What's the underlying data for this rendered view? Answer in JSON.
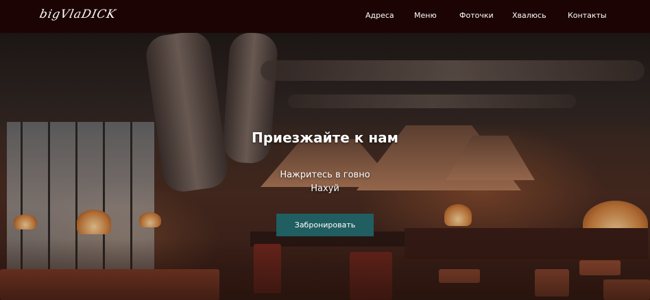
{
  "header": {
    "logo": "bigVlaDICK",
    "nav": [
      "Адреса",
      "Меню",
      "Фоточки",
      "Хвалюсь",
      "Контакты"
    ]
  },
  "hero": {
    "title": "Приезжайте к нам",
    "subtitle_line1": "Нажритесь в говно",
    "subtitle_line2": "Нахуй",
    "cta_label": "Забронировать"
  },
  "colors": {
    "header_bg": "#1c0405",
    "button_bg": "#215e61",
    "text": "#ffffff"
  }
}
